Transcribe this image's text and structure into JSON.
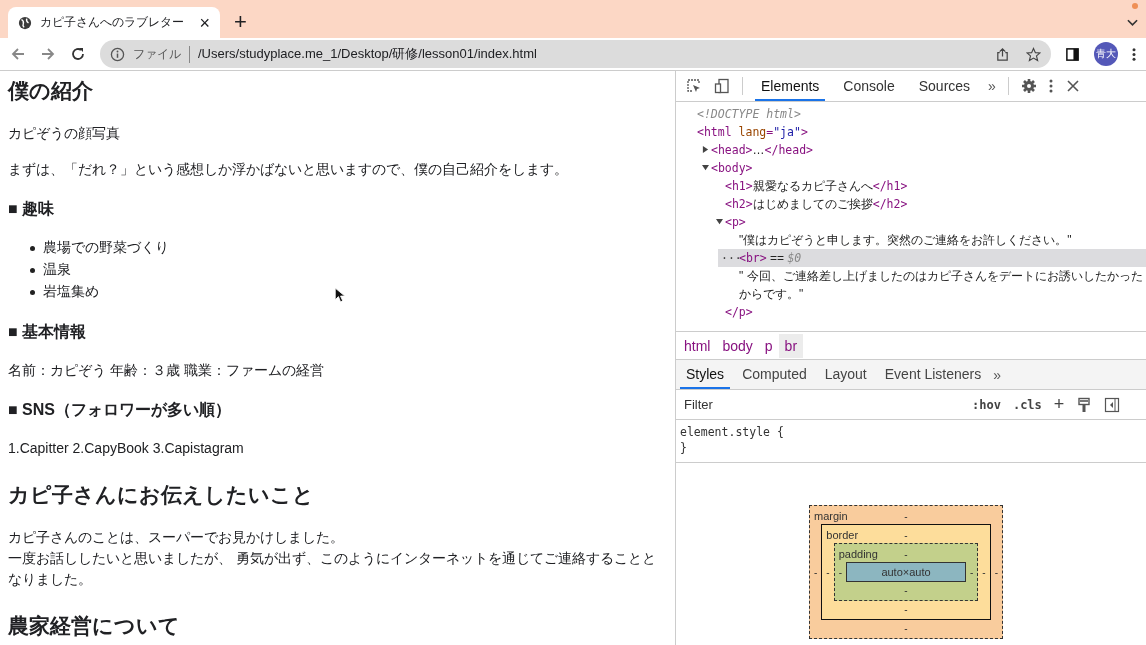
{
  "tab": {
    "title": "カピ子さんへのラブレター",
    "close": "×",
    "new_tab": "+"
  },
  "address_bar": {
    "scheme": "ファイル",
    "url": "/Users/studyplace.me_1/Desktop/研修/lesson01/index.html"
  },
  "profile": {
    "initials": "青大"
  },
  "page": [
    {
      "kind": "h2",
      "text": "僕の紹介"
    },
    {
      "kind": "p",
      "text": "カピぞうの顔写真"
    },
    {
      "kind": "p",
      "text": "まずは、「だれ？」という感想しか浮かばないと思いますので、僕の自己紹介をします。"
    },
    {
      "kind": "h3",
      "text": "■ 趣味"
    },
    {
      "kind": "ul",
      "items": [
        "農場での野菜づくり",
        "温泉",
        "岩塩集め"
      ]
    },
    {
      "kind": "h3",
      "text": "■ 基本情報"
    },
    {
      "kind": "p",
      "text": "名前：カピぞう 年齢：３歳 職業：ファームの経営"
    },
    {
      "kind": "h3",
      "text": "■ SNS（フォロワーが多い順）"
    },
    {
      "kind": "p",
      "text": "1.Capitter 2.CapyBook 3.Capistagram"
    },
    {
      "kind": "h2",
      "text": "カピ子さんにお伝えしたいこと"
    },
    {
      "kind": "lines",
      "lines": [
        "カピ子さんのことは、スーパーでお見かけしました。",
        "一度お話ししたいと思いましたが、 勇気が出ず、このようにインターネットを通じてご連絡することとなりました。"
      ]
    },
    {
      "kind": "h2",
      "text": "農家経営について"
    }
  ],
  "devtools": {
    "tabs": [
      {
        "label": "Elements",
        "selected": true
      },
      {
        "label": "Console",
        "selected": false
      },
      {
        "label": "Sources",
        "selected": false
      }
    ],
    "more": "»",
    "tree": [
      {
        "parts": [
          {
            "kind": "comment",
            "text": "<!DOCTYPE html>"
          }
        ]
      },
      {
        "parts": [
          {
            "kind": "tag",
            "text": "<html "
          },
          {
            "kind": "attr",
            "text": "lang"
          },
          {
            "kind": "tag",
            "text": "="
          },
          {
            "kind": "value",
            "text": "\"ja\""
          },
          {
            "kind": "tag",
            "text": ">"
          }
        ],
        "children": [
          {
            "expanded": false,
            "parts": [
              {
                "kind": "tag",
                "text": "<head>"
              },
              {
                "kind": "text",
                "text": "…"
              },
              {
                "kind": "tag",
                "text": "</head>"
              }
            ]
          },
          {
            "expanded": true,
            "parts": [
              {
                "kind": "tag",
                "text": "<body>"
              }
            ],
            "children": [
              {
                "parts": [
                  {
                    "kind": "tag",
                    "text": "<h1>"
                  },
                  {
                    "kind": "text",
                    "text": "親愛なるカピ子さんへ"
                  },
                  {
                    "kind": "tag",
                    "text": "</h1>"
                  }
                ]
              },
              {
                "parts": [
                  {
                    "kind": "tag",
                    "text": "<h2>"
                  },
                  {
                    "kind": "text",
                    "text": "はじめましてのご挨拶"
                  },
                  {
                    "kind": "tag",
                    "text": "</h2>"
                  }
                ]
              },
              {
                "expanded": true,
                "parts": [
                  {
                    "kind": "tag",
                    "text": "<p>"
                  }
                ],
                "children": [
                  {
                    "parts": [
                      {
                        "kind": "text",
                        "text": "\"僕はカピぞうと申します。突然のご連絡をお許しください。\""
                      }
                    ]
                  },
                  {
                    "selected": true,
                    "gutter": "···",
                    "parts": [
                      {
                        "kind": "tag",
                        "text": "<br>"
                      },
                      {
                        "kind": "text",
                        "text": " == "
                      },
                      {
                        "kind": "comment",
                        "text": "$0"
                      }
                    ]
                  },
                  {
                    "parts": [
                      {
                        "kind": "text",
                        "text": "\" 今回、ご連絡差し上げましたのはカピ子さんをデートにお誘いしたかったからです。\""
                      }
                    ]
                  }
                ]
              },
              {
                "parts": [
                  {
                    "kind": "tag",
                    "text": "</p>"
                  }
                ]
              }
            ]
          }
        ]
      }
    ],
    "breadcrumbs": [
      {
        "label": "html",
        "selected": false
      },
      {
        "label": "body",
        "selected": false
      },
      {
        "label": "p",
        "selected": false
      },
      {
        "label": "br",
        "selected": true
      }
    ],
    "style_tabs": [
      {
        "label": "Styles",
        "selected": true
      },
      {
        "label": "Computed",
        "selected": false
      },
      {
        "label": "Layout",
        "selected": false
      },
      {
        "label": "Event Listeners",
        "selected": false
      }
    ],
    "style_more": "»",
    "filter": {
      "placeholder": "Filter"
    },
    "hov": ":hov",
    "cls": ".cls",
    "add": "+",
    "rule": {
      "selector": "element.style {",
      "close": "}"
    },
    "box_model": {
      "label": "margin",
      "top": "-",
      "left": "-",
      "inner": {
        "label": "border",
        "top": "-",
        "left": "-",
        "inner": {
          "label": "padding",
          "top": "-",
          "left": "-",
          "content": "auto×auto",
          "right": "-",
          "bottom": "-"
        },
        "right": "-",
        "bottom": "-"
      },
      "right": "-",
      "bottom": "-"
    }
  }
}
